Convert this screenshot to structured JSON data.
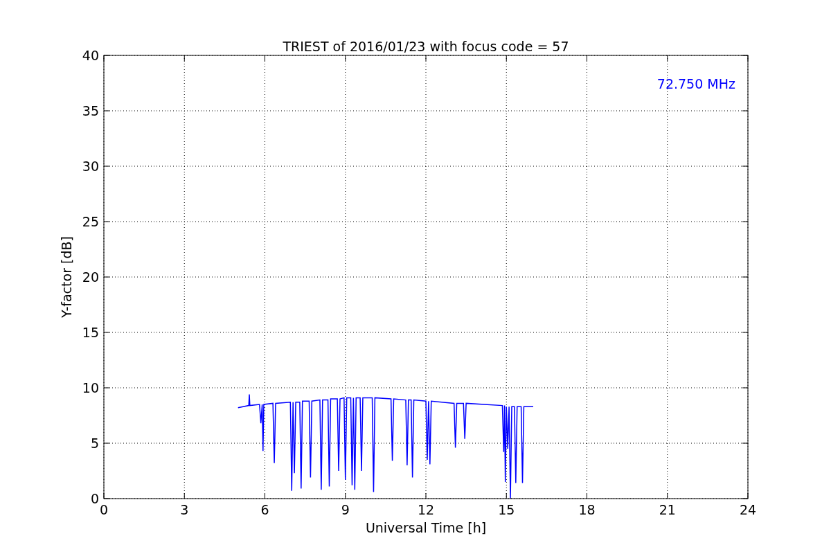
{
  "figure": {
    "chart_data": {
      "type": "line",
      "title": "TRIEST of 2016/01/23 with focus code = 57",
      "xlabel": "Universal Time [h]",
      "ylabel": "Y-factor [dB]",
      "xlim": [
        0,
        24
      ],
      "ylim": [
        0,
        40
      ],
      "xticks": [
        0,
        3,
        6,
        9,
        12,
        15,
        18,
        21,
        24
      ],
      "yticks": [
        0,
        5,
        10,
        15,
        20,
        25,
        30,
        35,
        40
      ],
      "x": [
        5.0,
        5.4,
        5.42,
        5.44,
        5.8,
        5.85,
        5.9,
        5.93,
        5.96,
        6.3,
        6.35,
        6.4,
        6.95,
        7.0,
        7.05,
        7.1,
        7.15,
        7.3,
        7.35,
        7.4,
        7.65,
        7.7,
        7.75,
        8.05,
        8.1,
        8.15,
        8.35,
        8.4,
        8.45,
        8.7,
        8.75,
        8.8,
        8.95,
        9.0,
        9.05,
        9.2,
        9.25,
        9.3,
        9.35,
        9.4,
        9.55,
        9.6,
        9.65,
        10.0,
        10.05,
        10.1,
        10.7,
        10.75,
        10.8,
        11.25,
        11.3,
        11.35,
        11.45,
        11.5,
        11.55,
        12.0,
        12.05,
        12.1,
        12.15,
        12.2,
        13.05,
        13.1,
        13.15,
        13.4,
        13.45,
        13.5,
        14.85,
        14.9,
        14.93,
        14.96,
        15.0,
        15.05,
        15.1,
        15.15,
        15.2,
        15.3,
        15.35,
        15.4,
        15.55,
        15.6,
        15.65,
        16.0
      ],
      "series": [
        {
          "name": "72.750 MHz",
          "color": "#0000ff",
          "values": [
            8.2,
            8.4,
            9.4,
            8.4,
            8.5,
            6.8,
            8.5,
            4.3,
            8.5,
            8.6,
            3.2,
            8.6,
            8.7,
            0.7,
            8.7,
            2.3,
            8.7,
            8.7,
            0.9,
            8.8,
            8.8,
            1.9,
            8.8,
            8.9,
            0.8,
            8.9,
            8.9,
            1.1,
            9.0,
            9.0,
            2.5,
            9.0,
            9.1,
            1.7,
            9.1,
            9.1,
            1.2,
            9.1,
            0.8,
            9.1,
            9.1,
            2.5,
            9.1,
            9.1,
            0.6,
            9.1,
            9.0,
            3.4,
            9.0,
            8.9,
            3.0,
            8.9,
            8.9,
            1.9,
            8.9,
            8.8,
            3.5,
            8.8,
            3.1,
            8.8,
            8.6,
            4.6,
            8.6,
            8.6,
            5.4,
            8.6,
            8.4,
            4.2,
            8.4,
            1.5,
            8.3,
            4.5,
            8.3,
            0.0,
            8.3,
            8.3,
            1.4,
            8.3,
            8.3,
            1.4,
            8.3,
            8.3
          ]
        }
      ],
      "grid": true
    }
  }
}
